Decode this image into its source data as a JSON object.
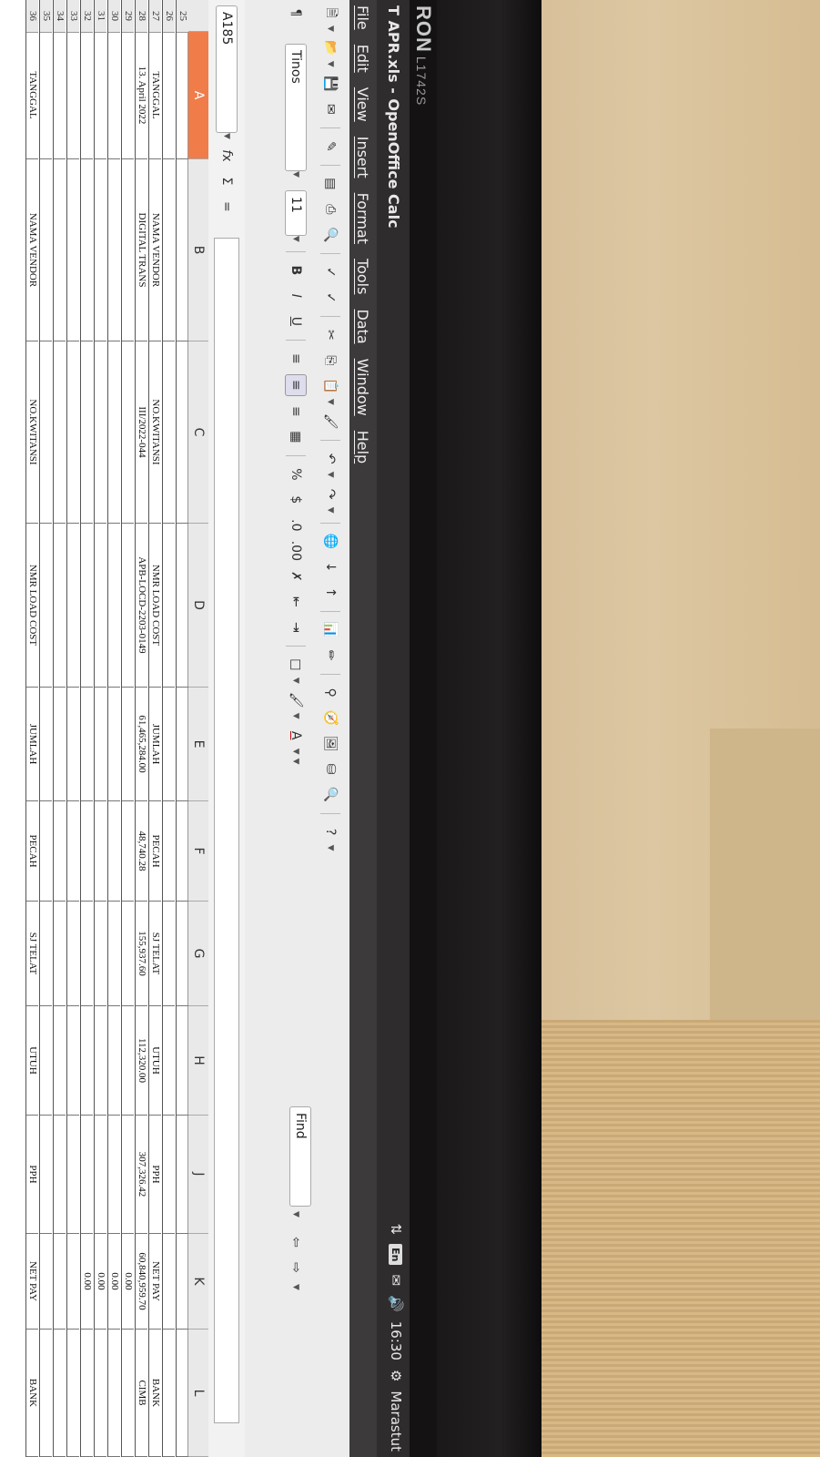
{
  "monitor": {
    "brand": "RON",
    "model": "L1742S"
  },
  "window": {
    "title": "T APR.xls - OpenOffice Calc"
  },
  "tray": {
    "lang": "En",
    "time": "16:30",
    "user": "Marastut"
  },
  "menu": [
    "File",
    "Edit",
    "View",
    "Insert",
    "Format",
    "Tools",
    "Data",
    "Window",
    "Help"
  ],
  "format": {
    "font_name": "Tinos",
    "font_size": "11",
    "find_placeholder": "Find"
  },
  "name_box": "A185",
  "columns": [
    "A",
    "B",
    "C",
    "D",
    "E",
    "F",
    "G",
    "H",
    "J",
    "K",
    "L"
  ],
  "rows": [
    {
      "n": "25",
      "cells": [
        "",
        "",
        "",
        "",
        "",
        "",
        "",
        "",
        "",
        "",
        ""
      ]
    },
    {
      "n": "26",
      "cells": [
        "",
        "",
        "",
        "",
        "",
        "",
        "",
        "",
        "",
        "",
        ""
      ]
    },
    {
      "n": "27",
      "cells": [
        "TANGGAL",
        "NAMA VENDOR",
        "NO.KWITANSI",
        "NMR LOAD COST",
        "JUMLAH",
        "PECAH",
        "SJ TELAT",
        "UTUH",
        "PPH",
        "NET PAY",
        "BANK"
      ]
    },
    {
      "n": "28",
      "cells": [
        "13. April 2022",
        "DIGITAL TRANS",
        "III/2022-044",
        "APB-LOCD-2203-0149",
        "61,465,284.00",
        "48,740.28",
        "155,937.60",
        "112,320.00",
        "307,326.42",
        "60,840,959.70",
        "CIMB"
      ]
    },
    {
      "n": "29",
      "cells": [
        "",
        "",
        "",
        "",
        "",
        "",
        "",
        "",
        "",
        "0.00",
        ""
      ]
    },
    {
      "n": "30",
      "cells": [
        "",
        "",
        "",
        "",
        "",
        "",
        "",
        "",
        "",
        "0.00",
        ""
      ]
    },
    {
      "n": "31",
      "cells": [
        "",
        "",
        "",
        "",
        "",
        "",
        "",
        "",
        "",
        "0.00",
        ""
      ]
    },
    {
      "n": "32",
      "cells": [
        "",
        "",
        "",
        "",
        "",
        "",
        "",
        "",
        "",
        "0.00",
        ""
      ]
    },
    {
      "n": "33",
      "cells": [
        "",
        "",
        "",
        "",
        "",
        "",
        "",
        "",
        "",
        "",
        ""
      ]
    },
    {
      "n": "34",
      "cells": [
        "",
        "",
        "",
        "",
        "",
        "",
        "",
        "",
        "",
        "",
        ""
      ]
    },
    {
      "n": "35",
      "cells": [
        "",
        "",
        "",
        "",
        "",
        "",
        "",
        "",
        "",
        "",
        ""
      ]
    },
    {
      "n": "36",
      "cells": [
        "TANGGAL",
        "NAMA VENDOR",
        "NO.KWITANSI",
        "NMR LOAD COST",
        "JUMLAH",
        "PECAH",
        "SJ TELAT",
        "UTUH",
        "PPH",
        "NET PAY",
        "BANK"
      ]
    }
  ],
  "selected_column": "A"
}
